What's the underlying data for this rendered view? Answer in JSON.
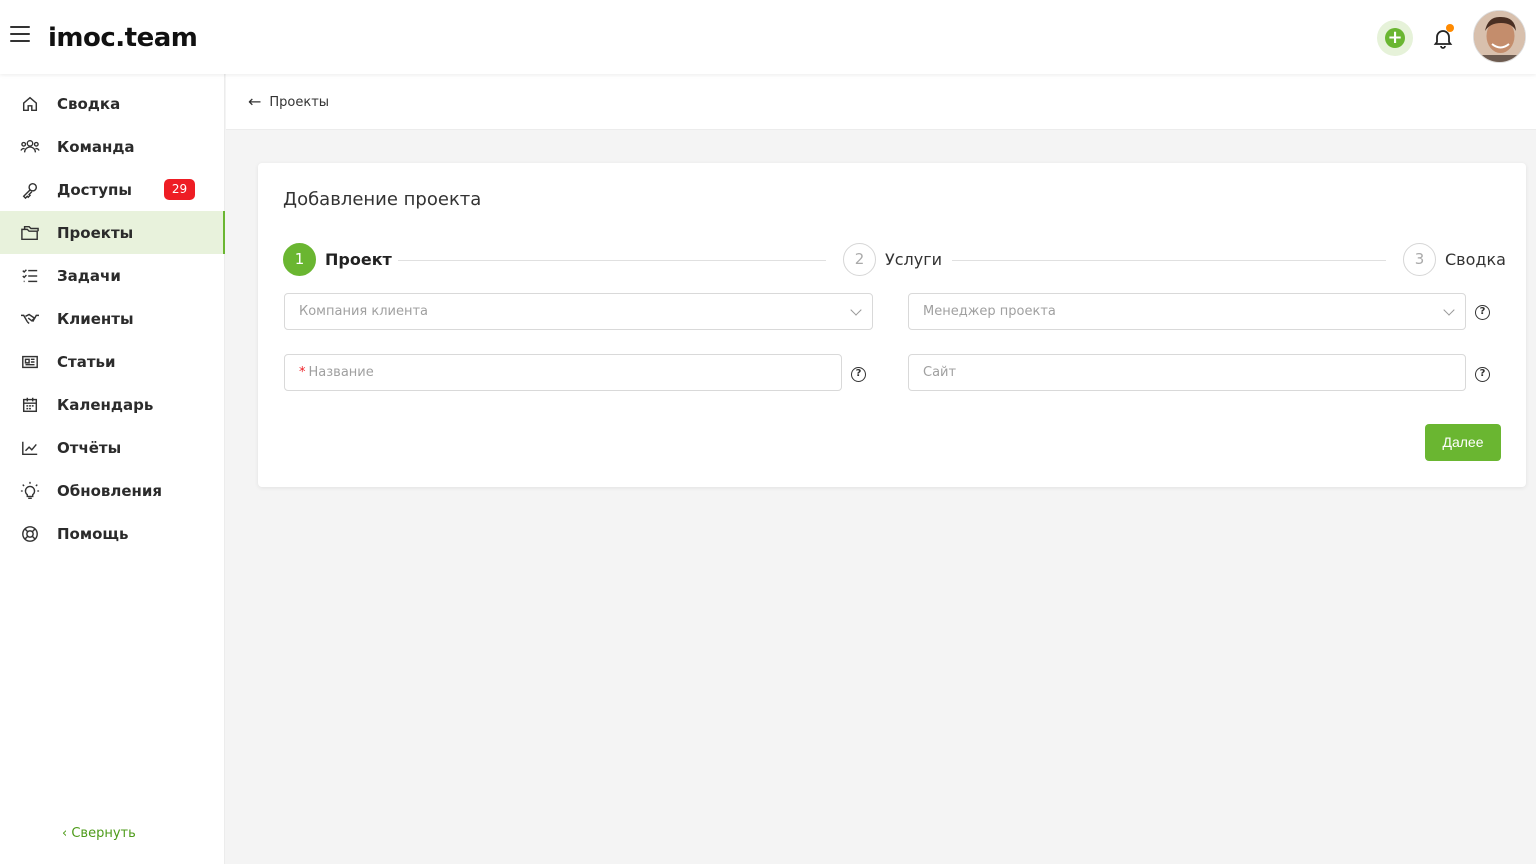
{
  "header": {
    "logo_text": "imoc.team",
    "add_symbol": "+"
  },
  "sidebar": {
    "items": [
      {
        "label": "Сводка",
        "icon": "home-icon"
      },
      {
        "label": "Команда",
        "icon": "team-icon"
      },
      {
        "label": "Доступы",
        "icon": "key-icon",
        "badge": "29"
      },
      {
        "label": "Проекты",
        "icon": "folders-icon",
        "active": true
      },
      {
        "label": "Задачи",
        "icon": "tasks-icon"
      },
      {
        "label": "Клиенты",
        "icon": "handshake-icon"
      },
      {
        "label": "Статьи",
        "icon": "articles-icon"
      },
      {
        "label": "Календарь",
        "icon": "calendar-icon"
      },
      {
        "label": "Отчёты",
        "icon": "chart-icon"
      },
      {
        "label": "Обновления",
        "icon": "lightbulb-icon"
      },
      {
        "label": "Помощь",
        "icon": "lifebuoy-icon"
      }
    ],
    "collapse_label": "Свернуть"
  },
  "breadcrumb": {
    "back_label": "Проекты"
  },
  "form": {
    "title": "Добавление проекта",
    "steps": [
      {
        "num": "1",
        "label": "Проект",
        "state": "current"
      },
      {
        "num": "2",
        "label": "Услуги",
        "state": "todo"
      },
      {
        "num": "3",
        "label": "Сводка",
        "state": "todo"
      }
    ],
    "client_company_placeholder": "Компания клиента",
    "project_manager_placeholder": "Менеджер проекта",
    "name_placeholder": "Название",
    "name_required_mark": "*",
    "site_placeholder": "Сайт",
    "help_symbol": "?",
    "next_label": "Далее"
  },
  "colors": {
    "accent": "#6ab631",
    "badge": "#ee1d24",
    "notification_dot": "#ff8a00"
  }
}
